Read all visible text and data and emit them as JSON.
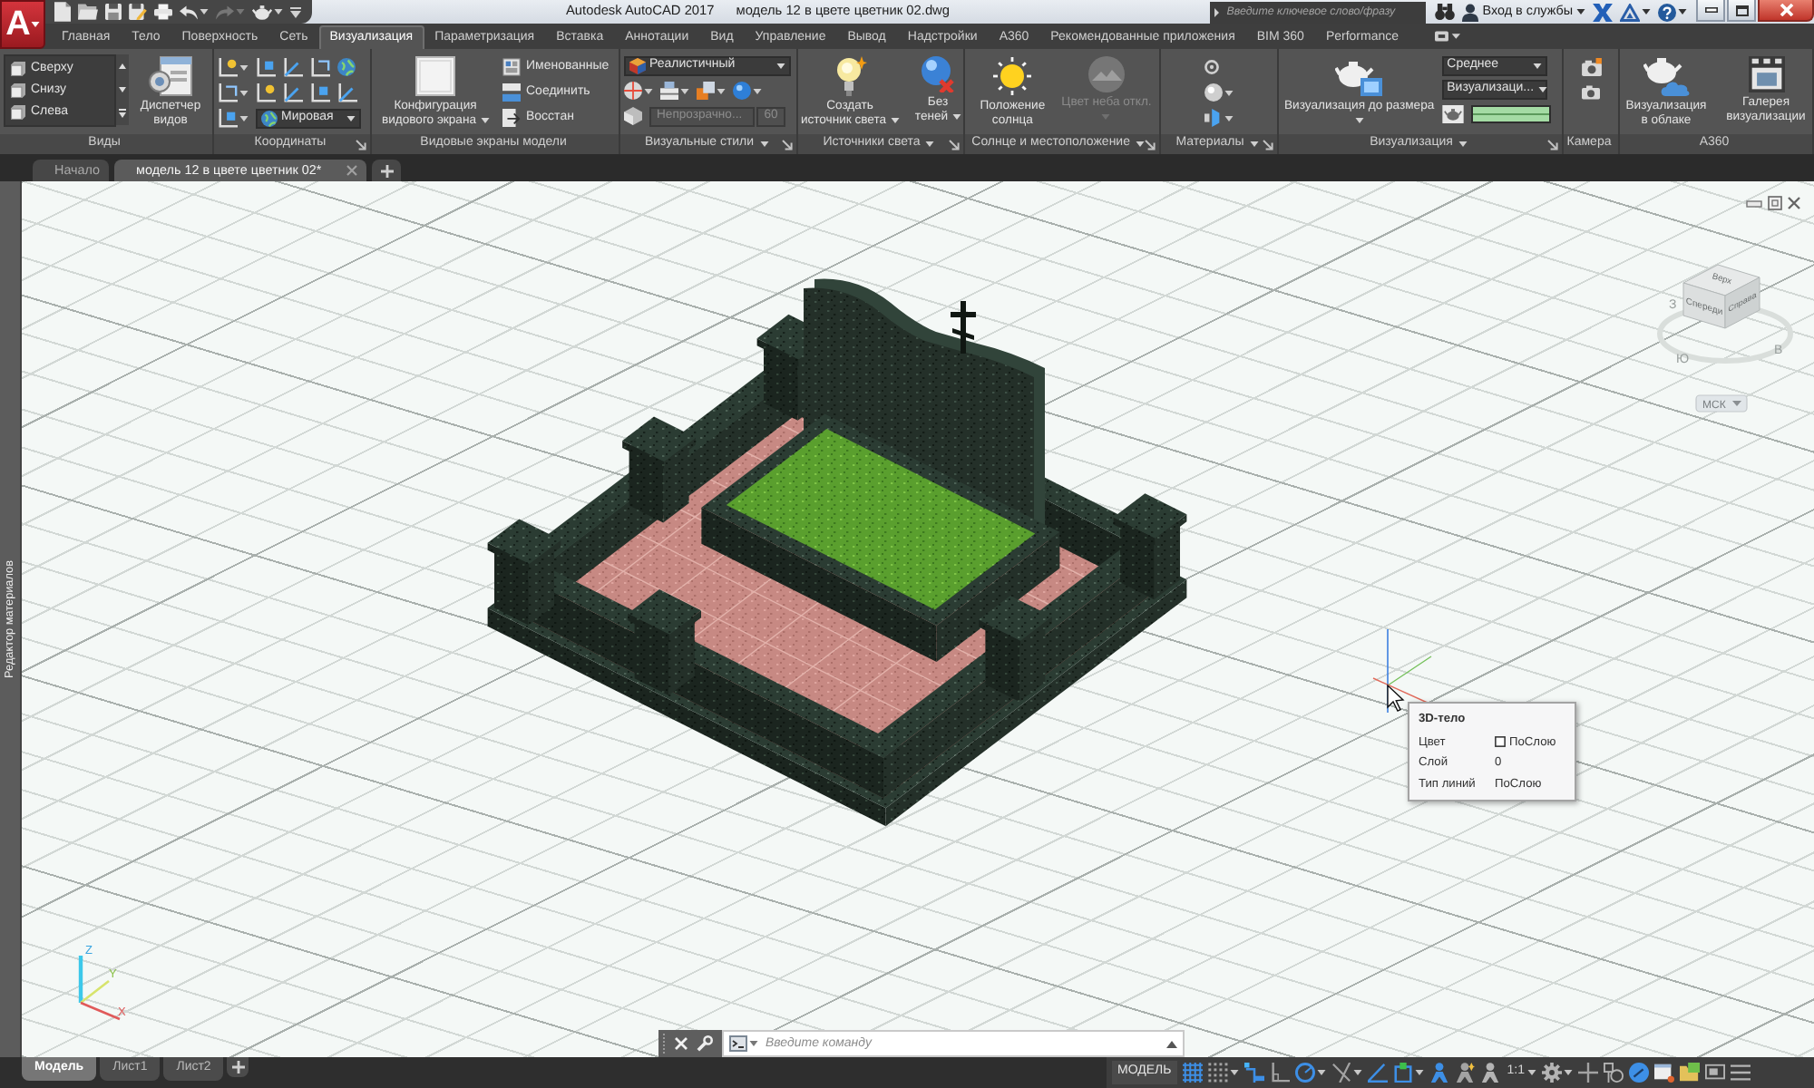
{
  "title_bar": {
    "app_letter": "A",
    "quick_access": [
      {
        "kind": "new",
        "disabled": false
      },
      {
        "kind": "open",
        "disabled": false
      },
      {
        "kind": "save",
        "disabled": false
      },
      {
        "kind": "save_as",
        "disabled": false
      },
      {
        "kind": "print",
        "disabled": false
      },
      {
        "kind": "undo",
        "disabled": false
      },
      {
        "kind": "redo",
        "disabled": true
      },
      {
        "kind": "share",
        "disabled": false
      }
    ],
    "app_title": "Autodesk AutoCAD 2017",
    "document_title": "модель 12 в цвете цветник 02.dwg",
    "search": {
      "placeholder": "Введите ключевое слово/фразу"
    },
    "sign_in": "Вход в службы"
  },
  "ribbon_tabs": [
    {
      "label": "Главная",
      "selected": false
    },
    {
      "label": "Тело",
      "selected": false
    },
    {
      "label": "Поверхность",
      "selected": false
    },
    {
      "label": "Сеть",
      "selected": false
    },
    {
      "label": "Визуализация",
      "selected": true
    },
    {
      "label": "Параметризация",
      "selected": false
    },
    {
      "label": "Вставка",
      "selected": false
    },
    {
      "label": "Аннотации",
      "selected": false
    },
    {
      "label": "Вид",
      "selected": false
    },
    {
      "label": "Управление",
      "selected": false
    },
    {
      "label": "Вывод",
      "selected": false
    },
    {
      "label": "Надстройки",
      "selected": false
    },
    {
      "label": "A360",
      "selected": false
    },
    {
      "label": "Рекомендованные приложения",
      "selected": false
    },
    {
      "label": "BIM 360",
      "selected": false
    },
    {
      "label": "Performance",
      "selected": false
    }
  ],
  "ribbon_panels": [
    {
      "kind": "views",
      "title": "Виды",
      "views": [
        "Сверху",
        "Снизу",
        "Слева"
      ],
      "manager": "Диспетчер видов"
    },
    {
      "kind": "coordinates",
      "title": "Координаты",
      "ucs": "Мировая"
    },
    {
      "kind": "viewports",
      "title": "Видовые экраны модели",
      "configure": "Конфигурация видового экрана",
      "actions": [
        "Именованные",
        "Соединить",
        "Восстан"
      ]
    },
    {
      "kind": "visual_styles",
      "title": "Визуальные стили",
      "style": "Реалистичный",
      "opacity": {
        "label": "Непрозрачно...",
        "value": "60",
        "disabled": true
      }
    },
    {
      "kind": "lights",
      "title": "Источники света",
      "buttons": [
        "Создать источник света",
        "Без теней"
      ]
    },
    {
      "kind": "sun",
      "title": "Солнце и местоположение",
      "buttons": [
        {
          "label": "Положение солнца",
          "disabled": false
        },
        {
          "label": "Цвет неба откл.",
          "disabled": true
        }
      ]
    },
    {
      "kind": "materials",
      "title": "Материалы"
    },
    {
      "kind": "render",
      "title": "Визуализация",
      "button": "Визуализация до размера",
      "preset": "Среднее",
      "target": "Визуализаци...",
      "progress": {
        "level": 1
      }
    },
    {
      "kind": "camera",
      "title": "Камера"
    },
    {
      "kind": "cloud",
      "title": "A360",
      "buttons": [
        "Визуализация в облаке",
        "Галерея визуализации"
      ]
    }
  ],
  "file_tabs": [
    {
      "label": "Начало",
      "selected": false
    },
    {
      "label": "модель 12 в цвете цветник 02*",
      "selected": true
    }
  ],
  "viewport": {
    "palette": "Редактор материалов",
    "viewcube": {
      "faces": [
        "Верх",
        "Спереди",
        "Справа"
      ],
      "compass": [
        "З",
        "Ю",
        "В"
      ],
      "ucs": "МСК"
    },
    "axes": [
      "Z",
      "Y",
      "X"
    ],
    "tooltip": {
      "title": "3D-тело",
      "rows": [
        {
          "kind": "color",
          "label": "Цвет",
          "value": "ПоСлою"
        },
        {
          "kind": "text",
          "label": "Слой",
          "value": "0"
        },
        {
          "kind": "text",
          "label": "Тип линий",
          "value": "ПоСлою"
        }
      ]
    },
    "command_line": {
      "placeholder": "Введите команду"
    }
  },
  "layout_tabs": [
    {
      "label": "Модель",
      "selected": true
    },
    {
      "label": "Лист1",
      "selected": false
    },
    {
      "label": "Лист2",
      "selected": false
    }
  ],
  "status_bar": {
    "items": [
      {
        "kind": "space",
        "text": "МОДЕЛЬ"
      },
      {
        "kind": "grid",
        "on": true
      },
      {
        "kind": "snap",
        "on": false
      },
      {
        "kind": "infer",
        "on": true
      },
      {
        "kind": "ortho",
        "on": false
      },
      {
        "kind": "polar",
        "on": true
      },
      {
        "kind": "isodraft",
        "on": false
      },
      {
        "kind": "otrack",
        "on": true
      },
      {
        "kind": "osnap",
        "on": true
      },
      {
        "kind": "annovis",
        "on": true
      },
      {
        "kind": "autoscale",
        "on": false
      },
      {
        "kind": "annoscale"
      },
      {
        "kind": "scale",
        "text": "1:1"
      },
      {
        "kind": "workspace"
      },
      {
        "kind": "monitor",
        "on": false
      },
      {
        "kind": "isolate"
      },
      {
        "kind": "hwaccel",
        "on": true
      },
      {
        "kind": "properties"
      },
      {
        "kind": "lock"
      },
      {
        "kind": "cleanscreen"
      },
      {
        "kind": "customize"
      }
    ]
  }
}
